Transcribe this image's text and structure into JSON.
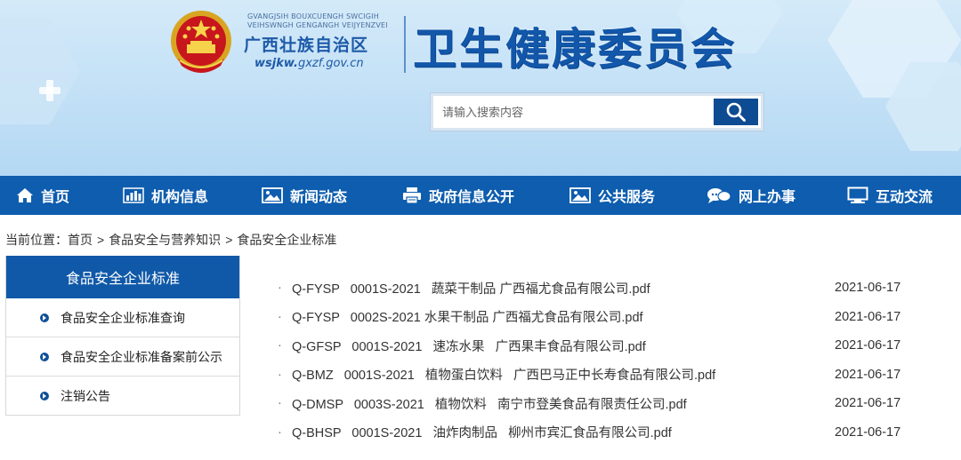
{
  "header": {
    "zhuang_line1": "GVANGJSIH BOUXCUENGH SWCIGIH",
    "zhuang_line2": "VEIHSWNGH GENGANGH VEIJYENZVEI",
    "region_name": "广西壮族自治区",
    "site_url_bold": "wsjkw.",
    "site_url_rest": "gxzf.gov.cn",
    "main_title": "卫生健康委员会"
  },
  "search": {
    "placeholder": "请输入搜索内容",
    "icon": "search-icon"
  },
  "nav": {
    "items": [
      {
        "label": "首页",
        "icon": "home-icon"
      },
      {
        "label": "机构信息",
        "icon": "bar-chart-icon"
      },
      {
        "label": "新闻动态",
        "icon": "image-icon"
      },
      {
        "label": "政府信息公开",
        "icon": "printer-icon"
      },
      {
        "label": "公共服务",
        "icon": "image-icon"
      },
      {
        "label": "网上办事",
        "icon": "chat-icon"
      },
      {
        "label": "互动交流",
        "icon": "monitor-icon"
      }
    ]
  },
  "breadcrumb": {
    "prefix": "当前位置：",
    "items": [
      "首页",
      "食品安全与营养知识",
      "食品安全企业标准"
    ],
    "separator": ">"
  },
  "sidebar": {
    "title": "食品安全企业标准",
    "items": [
      {
        "label": "食品安全企业标准查询"
      },
      {
        "label": "食品安全企业标准备案前公示"
      },
      {
        "label": "注销公告"
      }
    ]
  },
  "list": {
    "bullet": "·",
    "rows": [
      {
        "title": "Q-FYSP   0001S-2021   蔬菜干制品 广西福尤食品有限公司.pdf",
        "date": "2021-06-17"
      },
      {
        "title": "Q-FYSP   0002S-2021 水果干制品 广西福尤食品有限公司.pdf",
        "date": "2021-06-17"
      },
      {
        "title": "Q-GFSP   0001S-2021   速冻水果   广西果丰食品有限公司.pdf",
        "date": "2021-06-17"
      },
      {
        "title": "Q-BMZ   0001S-2021   植物蛋白饮料   广西巴马正中长寿食品有限公司.pdf",
        "date": "2021-06-17"
      },
      {
        "title": "Q-DMSP   0003S-2021   植物饮料   南宁市登美食品有限责任公司.pdf",
        "date": "2021-06-17"
      },
      {
        "title": "Q-BHSP   0001S-2021   油炸肉制品   柳州市宾汇食品有限公司.pdf",
        "date": "2021-06-17"
      }
    ]
  },
  "colors": {
    "nav_bg": "#0e5dae",
    "sidebar_header_bg": "#1059a8",
    "search_button_bg": "#0d4b93",
    "title_blue": "#1257a9",
    "header_bg_light": "#d4eaf9"
  }
}
